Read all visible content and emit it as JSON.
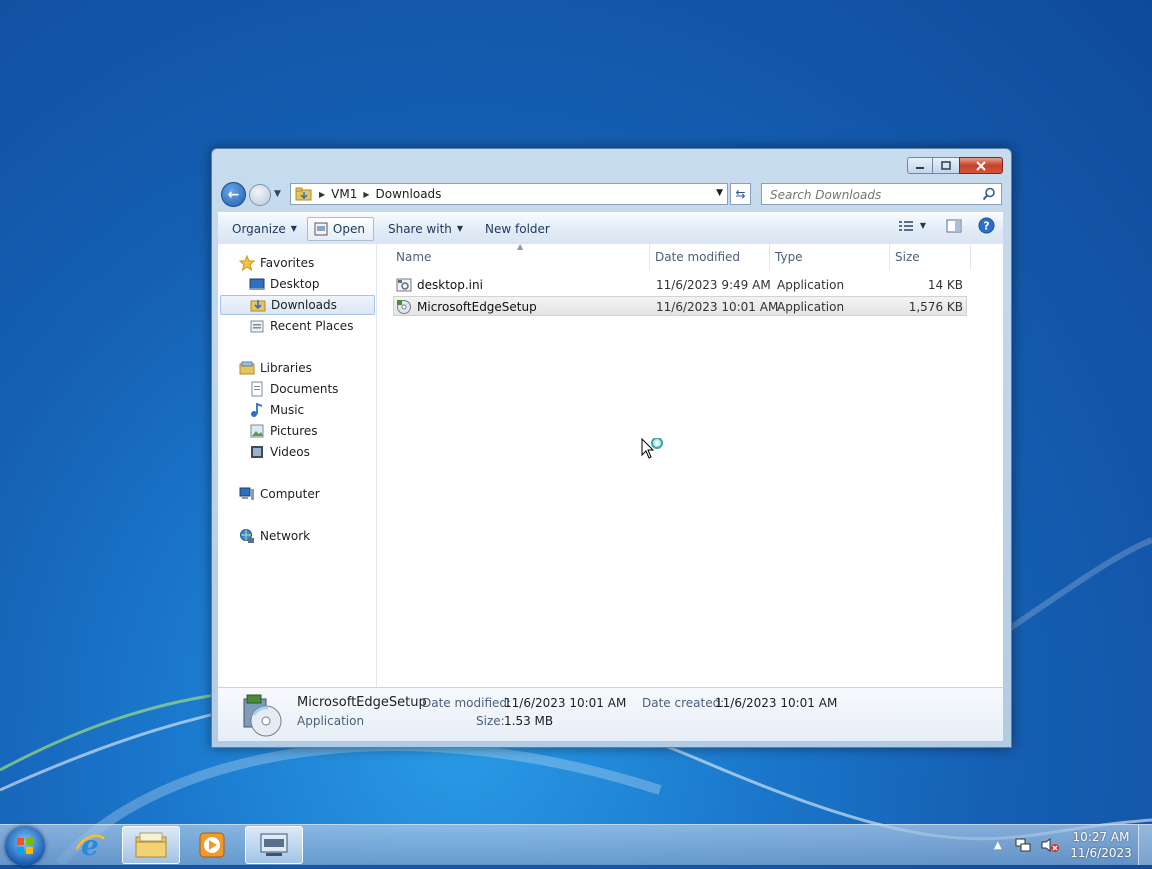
{
  "breadcrumb": {
    "root": "VM1",
    "current": "Downloads"
  },
  "search": {
    "placeholder": "Search Downloads"
  },
  "toolbar": {
    "organize": "Organize",
    "open": "Open",
    "share_with": "Share with",
    "new_folder": "New folder"
  },
  "nav": {
    "favorites": "Favorites",
    "desktop": "Desktop",
    "downloads": "Downloads",
    "recent_places": "Recent Places",
    "libraries": "Libraries",
    "documents": "Documents",
    "music": "Music",
    "pictures": "Pictures",
    "videos": "Videos",
    "computer": "Computer",
    "network": "Network"
  },
  "columns": {
    "name": "Name",
    "date_modified": "Date modified",
    "type": "Type",
    "size": "Size"
  },
  "files": [
    {
      "name": "desktop.ini",
      "date": "11/6/2023 9:49 AM",
      "type": "Application",
      "size": "14 KB"
    },
    {
      "name": "MicrosoftEdgeSetup",
      "date": "11/6/2023 10:01 AM",
      "type": "Application",
      "size": "1,576 KB"
    }
  ],
  "details": {
    "name": "MicrosoftEdgeSetup",
    "type": "Application",
    "date_modified_label": "Date modified:",
    "date_modified": "11/6/2023 10:01 AM",
    "size_label": "Size:",
    "size": "1.53 MB",
    "date_created_label": "Date created:",
    "date_created": "11/6/2023 10:01 AM"
  },
  "clock": {
    "time": "10:27 AM",
    "date": "11/6/2023"
  },
  "colors": {
    "accent": "#1d5fae",
    "selection": "#dbe7f5"
  }
}
